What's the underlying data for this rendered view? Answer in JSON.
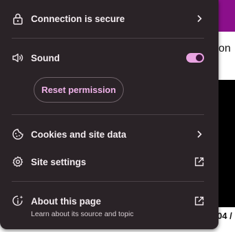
{
  "background": {
    "partial_text_top": "on",
    "partial_text_bottom": "04 /"
  },
  "popup": {
    "connection": {
      "label": "Connection is secure",
      "icon": "lock-icon",
      "trail_icon": "chevron-right-icon"
    },
    "sound": {
      "label": "Sound",
      "icon": "speaker-icon",
      "toggle_on": true
    },
    "reset_button": {
      "label": "Reset permission"
    },
    "cookies": {
      "label": "Cookies and site data",
      "icon": "cookie-icon",
      "trail_icon": "chevron-right-icon"
    },
    "site_settings": {
      "label": "Site settings",
      "icon": "gear-icon",
      "trail_icon": "external-link-icon"
    },
    "about": {
      "label": "About this page",
      "subtitle": "Learn about its source and topic",
      "icon": "info-sparkle-icon",
      "trail_icon": "external-link-icon"
    }
  },
  "colors": {
    "popup_bg": "#2a2327",
    "accent": "#f0b3ea",
    "toggle_track": "#e9a4e2",
    "page_purple": "#8b0f8b"
  }
}
